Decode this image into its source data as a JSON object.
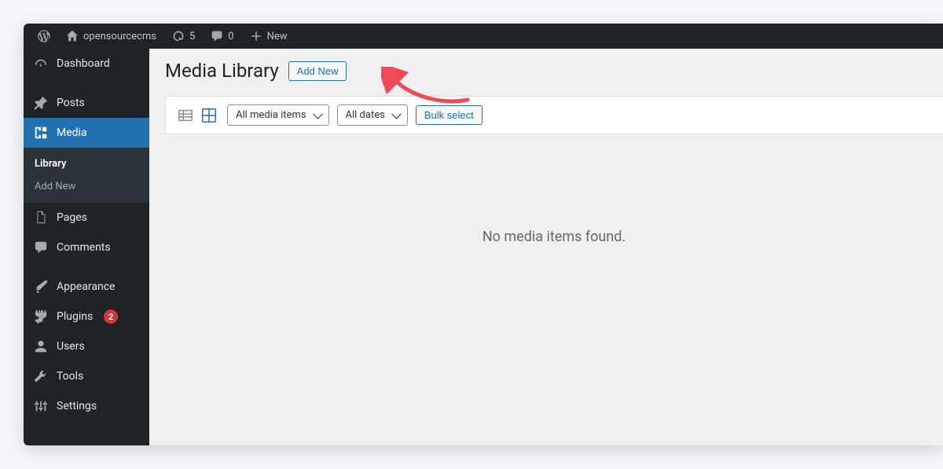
{
  "adminbar": {
    "site_name": "opensourcecms",
    "updates_count": "5",
    "comments_count": "0",
    "new_label": "New"
  },
  "sidebar": {
    "items": [
      {
        "label": "Dashboard"
      },
      {
        "label": "Posts"
      },
      {
        "label": "Media"
      },
      {
        "label": "Pages"
      },
      {
        "label": "Comments"
      },
      {
        "label": "Appearance"
      },
      {
        "label": "Plugins",
        "badge": "2"
      },
      {
        "label": "Users"
      },
      {
        "label": "Tools"
      },
      {
        "label": "Settings"
      }
    ],
    "media_submenu": {
      "library": "Library",
      "add_new": "Add New"
    }
  },
  "page": {
    "title": "Media Library",
    "add_new": "Add New"
  },
  "toolbar": {
    "filter_type": "All media items",
    "filter_date": "All dates",
    "bulk_select": "Bulk select"
  },
  "content": {
    "empty": "No media items found."
  }
}
